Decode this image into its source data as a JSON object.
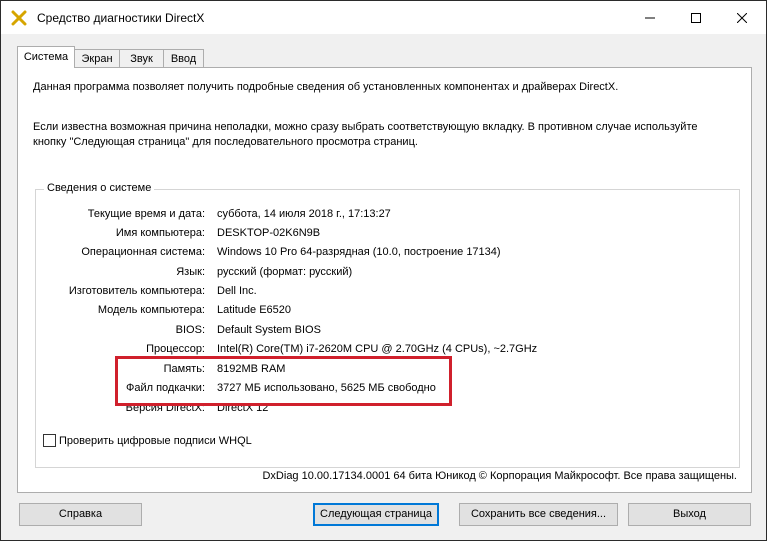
{
  "window": {
    "title": "Средство диагностики DirectX",
    "icon": "directx-icon"
  },
  "tabs": [
    {
      "label": "Система",
      "active": true
    },
    {
      "label": "Экран",
      "active": false
    },
    {
      "label": "Звук",
      "active": false
    },
    {
      "label": "Ввод",
      "active": false
    }
  ],
  "intro": {
    "line1": "Данная программа позволяет получить подробные сведения об установленных компонентах и драйверах DirectX.",
    "line2": "Если известна возможная причина неполадки, можно сразу выбрать соответствующую вкладку. В противном случае используйте",
    "line3": "кнопку \"Следующая страница\" для последовательного просмотра страниц."
  },
  "system_info": {
    "group_title": "Сведения о системе",
    "rows": [
      {
        "label": "Текущие время и дата:",
        "value": "суббота, 14 июля 2018 г., 17:13:27"
      },
      {
        "label": "Имя компьютера:",
        "value": "DESKTOP-02K6N9B"
      },
      {
        "label": "Операционная система:",
        "value": "Windows 10 Pro 64-разрядная (10.0, построение 17134)"
      },
      {
        "label": "Язык:",
        "value": "русский (формат: русский)"
      },
      {
        "label": "Изготовитель компьютера:",
        "value": "Dell Inc."
      },
      {
        "label": "Модель компьютера:",
        "value": "Latitude E6520"
      },
      {
        "label": "BIOS:",
        "value": "Default System BIOS"
      },
      {
        "label": "Процессор:",
        "value": "Intel(R) Core(TM) i7-2620M CPU @ 2.70GHz (4 CPUs), ~2.7GHz"
      },
      {
        "label": "Память:",
        "value": "8192MB RAM"
      },
      {
        "label": "Файл подкачки:",
        "value": "3727 МБ использовано, 5625 МБ свободно"
      },
      {
        "label": "Версия DirectX:",
        "value": "DirectX 12"
      }
    ]
  },
  "whql": {
    "label": "Проверить цифровые подписи WHQL",
    "checked": false
  },
  "copyright": "DxDiag 10.00.17134.0001 64 бита Юникод © Корпорация Майкрософт. Все права защищены.",
  "buttons": {
    "help": "Справка",
    "next": "Следующая страница",
    "save": "Сохранить все сведения...",
    "exit": "Выход"
  },
  "colors": {
    "highlight": "#d0202c",
    "default_button_border": "#0078d7"
  }
}
